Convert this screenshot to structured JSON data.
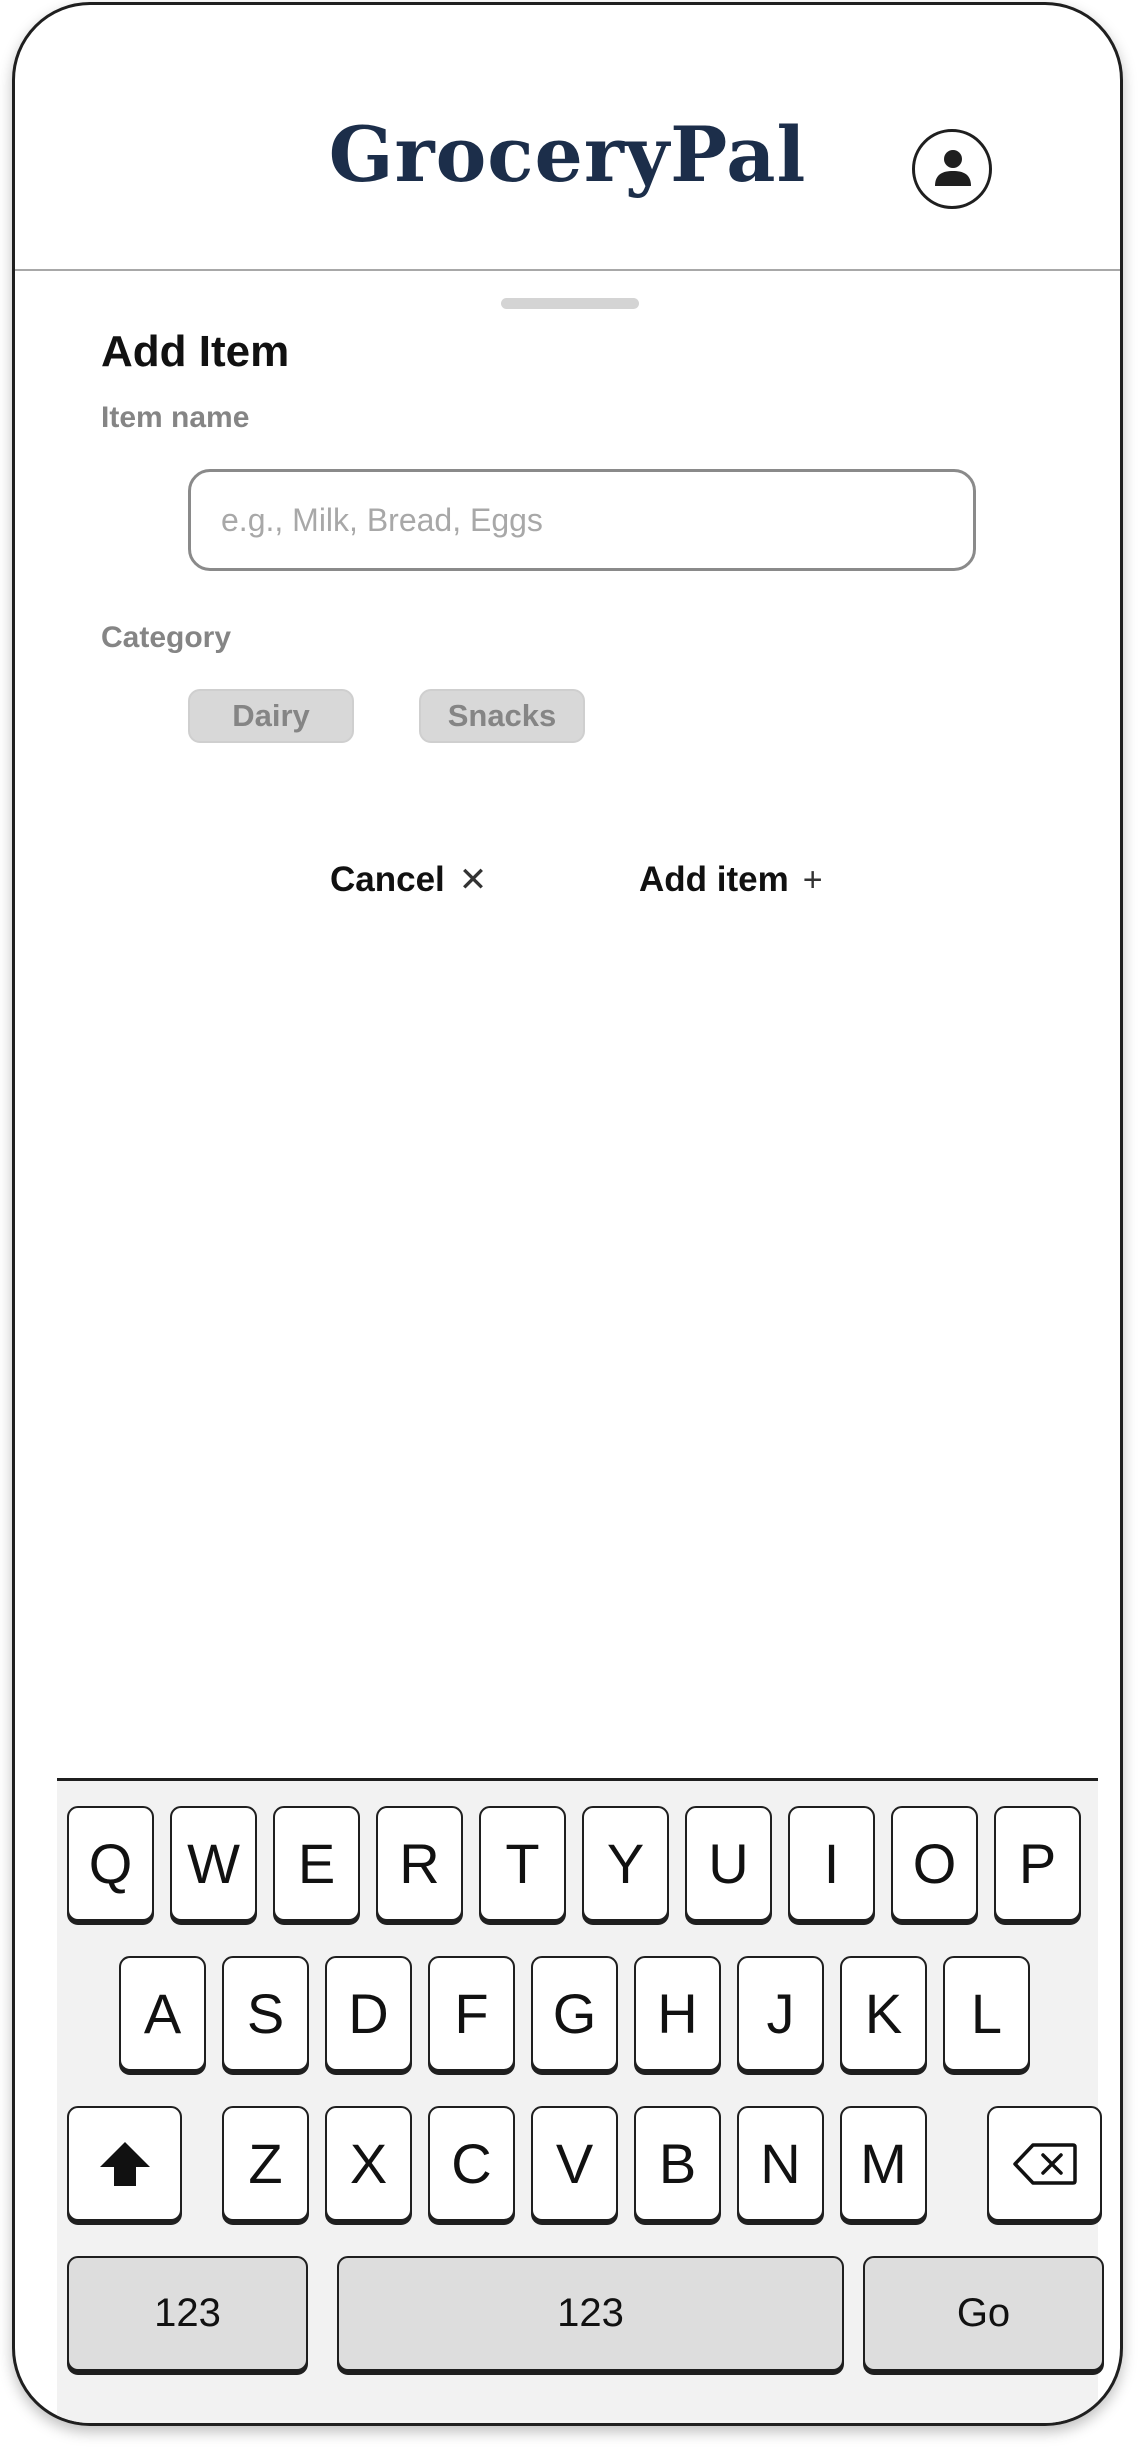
{
  "app": {
    "brand": "GroceryPal"
  },
  "sheet": {
    "title": "Add Item",
    "item_name_label": "Item name",
    "item_name_placeholder": "e.g., Milk, Bread, Eggs",
    "item_name_value": "",
    "category_label": "Category",
    "categories": [
      "Dairy",
      "Snacks"
    ],
    "cancel_label": "Cancel",
    "cancel_icon": "close-icon",
    "add_label": "Add item",
    "add_icon": "plus-icon"
  },
  "keyboard": {
    "row1": [
      "Q",
      "W",
      "E",
      "R",
      "T",
      "Y",
      "U",
      "I",
      "O",
      "P"
    ],
    "row2": [
      "A",
      "S",
      "D",
      "F",
      "G",
      "H",
      "J",
      "K",
      "L"
    ],
    "row3": [
      "Z",
      "X",
      "C",
      "V",
      "B",
      "N",
      "M"
    ],
    "shift_icon": "shift-icon",
    "backspace_icon": "backspace-icon",
    "numbers_label": "123",
    "space_label": "123",
    "go_label": "Go"
  },
  "colors": {
    "brand": "#1c2e4a",
    "muted_label": "#858585",
    "chip_bg": "#d8d8d8",
    "keyboard_bg": "#f2f2f2"
  }
}
